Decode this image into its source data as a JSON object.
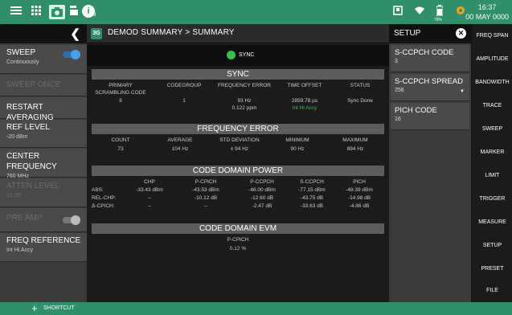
{
  "topbar": {
    "menu_icon": "hamburger-icon",
    "apps_icon": "grid-icon",
    "camera_icon": "camera-icon",
    "save_icon": "save-icon",
    "info_badge": "i",
    "info_sub": "9",
    "usb_icon": "usb-icon",
    "wifi_icon": "wifi-icon",
    "battery_icon": "battery-icon",
    "battery_pct": "79%",
    "gps_icon": "gps-icon",
    "time": "16:37",
    "date": "00 MAY 0000"
  },
  "left_panel": {
    "buttons": [
      {
        "label": "SWEEP",
        "sub": "Continuously",
        "toggle": "on",
        "disabled": false
      },
      {
        "label": "SWEEP ONCE",
        "sub": "",
        "disabled": true
      },
      {
        "label": "RESTART AVERAGING",
        "sub": "",
        "disabled": false
      },
      {
        "label": "REF LEVEL",
        "sub": "-20 dBm",
        "disabled": false
      },
      {
        "label": "CENTER FREQUENCY",
        "sub": "760 MHz",
        "disabled": false
      },
      {
        "label": "ATTEN LEVEL",
        "sub": "15 dB",
        "disabled": true
      },
      {
        "label": "PRE AMP",
        "sub": "",
        "toggle": "off",
        "disabled": true
      },
      {
        "label": "FREQ REFERENCE",
        "sub": "Int Hi Accy",
        "disabled": false
      }
    ]
  },
  "main": {
    "breadcrumb": "DEMOD SUMMARY  >  SUMMARY",
    "sync_status": "SYNC",
    "sync": {
      "title": "SYNC",
      "headers": [
        "PRIMARY SCRAMBLING CODE",
        "CODEGROUP",
        "FREQUENCY ERROR",
        "TIME OFFSET",
        "STATUS"
      ],
      "values": [
        "8",
        "1",
        "93 Hz",
        "2859.78 µs",
        "Sync Done"
      ],
      "sub_values": [
        "",
        "",
        "0.122 ppm",
        "Int Hi Accy",
        ""
      ]
    },
    "freq_error": {
      "title": "FREQUENCY ERROR",
      "headers": [
        "COUNT",
        "AVERAGE",
        "STD DEVIATION",
        "MINIMUM",
        "MAXIMUM"
      ],
      "values": [
        "73",
        "104 Hz",
        "± 94 Hz",
        "90 Hz",
        "894 Hz"
      ]
    },
    "cdp": {
      "title": "CODE DOMAIN POWER",
      "headers": [
        "CHP",
        "P-CPICH",
        "P-CCPCH",
        "S-CCPCH",
        "PICH"
      ],
      "rows": [
        {
          "label": "ABS:",
          "values": [
            "-33.43 dBm",
            "-43.53 dBm",
            "-46.00 dBm",
            "-77.15 dBm",
            "-48.39 dBm"
          ]
        },
        {
          "label": "REL-CHP:",
          "values": [
            "--",
            "-10.12 dB",
            "-12.60 dB",
            "-43.75 dB",
            "-14.98 dB"
          ]
        },
        {
          "label": "Δ-CPICH:",
          "values": [
            "--",
            "--",
            "-2.47 dB",
            "-33.63 dB",
            "-4.86 dB"
          ]
        }
      ]
    },
    "evm": {
      "title": "CODE DOMAIN EVM",
      "header": "P-CPICH",
      "value": "0.12 %"
    }
  },
  "setup": {
    "title": "SETUP",
    "items": [
      {
        "label": "S-CCPCH CODE",
        "value": "3"
      },
      {
        "label": "S-CCPCH SPREAD",
        "value": "256"
      },
      {
        "label": "PICH CODE",
        "value": "16"
      }
    ]
  },
  "right_menu": {
    "items": [
      "FREQ SPAN",
      "AMPLITUDE",
      "BANDWIDTH",
      "TRACE",
      "SWEEP",
      "MARKER",
      "LIMIT",
      "TRIGGER",
      "MEASURE",
      "SETUP",
      "PRESET",
      "FILE"
    ]
  },
  "bottom": {
    "shortcut_label": "SHORTCUT"
  },
  "colors": {
    "accent": "#2f8f6a",
    "sync_green": "#35c14c",
    "toggle_blue": "#47a0e8"
  }
}
